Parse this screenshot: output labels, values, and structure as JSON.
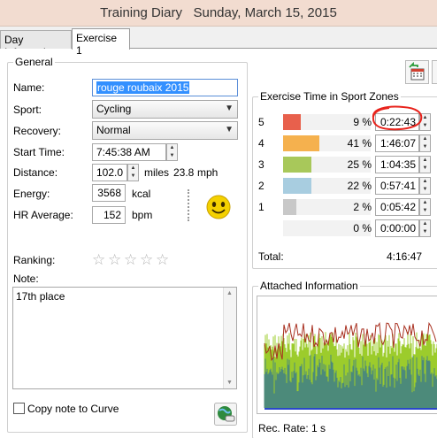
{
  "window": {
    "title": "Training Diary   Sunday, March 15, 2015"
  },
  "tabs": [
    {
      "label": "Day Information"
    },
    {
      "label": "Exercise 1"
    }
  ],
  "general": {
    "legend": "General",
    "name_label": "Name:",
    "name_value": "rouge roubaix 2015",
    "sport_label": "Sport:",
    "sport_value": "Cycling",
    "recovery_label": "Recovery:",
    "recovery_value": "Normal",
    "start_time_label": "Start Time:",
    "start_time_value": "7:45:38 AM",
    "distance_label": "Distance:",
    "distance_value": "102.0",
    "distance_unit": "miles",
    "speed_value": "23.8",
    "speed_unit": "mph",
    "energy_label": "Energy:",
    "energy_value": "3568",
    "energy_unit": "kcal",
    "hr_label": "HR Average:",
    "hr_value": "152",
    "hr_unit": "bpm",
    "ranking_label": "Ranking:",
    "ranking_stars": 0,
    "ranking_max": 5,
    "note_label": "Note:",
    "note_value": "17th place",
    "copy_note_label": "Copy note to Curve",
    "copy_note_checked": false,
    "mood_icon": "smiley-icon"
  },
  "zones": {
    "legend": "Exercise Time in Sport Zones",
    "rows": [
      {
        "zone": "5",
        "percent": "9 %",
        "time": "0:22:43",
        "fraction": 0.2,
        "color": "#e8604c"
      },
      {
        "zone": "4",
        "percent": "41 %",
        "time": "1:46:07",
        "fraction": 0.41,
        "color": "#f5b14e"
      },
      {
        "zone": "3",
        "percent": "25 %",
        "time": "1:04:35",
        "fraction": 0.32,
        "color": "#a8c85a"
      },
      {
        "zone": "2",
        "percent": "22 %",
        "time": "0:57:41",
        "fraction": 0.32,
        "color": "#a8cde0"
      },
      {
        "zone": "1",
        "percent": "2 %",
        "time": "0:05:42",
        "fraction": 0.15,
        "color": "#c8c8c8"
      },
      {
        "zone": "",
        "percent": "0 %",
        "time": "0:00:00",
        "fraction": 0,
        "color": "#c8c8c8"
      }
    ],
    "total_label": "Total:",
    "total_value": "4:16:47"
  },
  "attached": {
    "legend": "Attached Information",
    "rec_rate": "Rec. Rate: 1 s",
    "colors": {
      "bg": "#4c8a7a",
      "green": "#9ccc2c",
      "red": "#a83020",
      "blue": "#2a48c8"
    }
  },
  "annotation": {
    "color": "#e8231c"
  }
}
